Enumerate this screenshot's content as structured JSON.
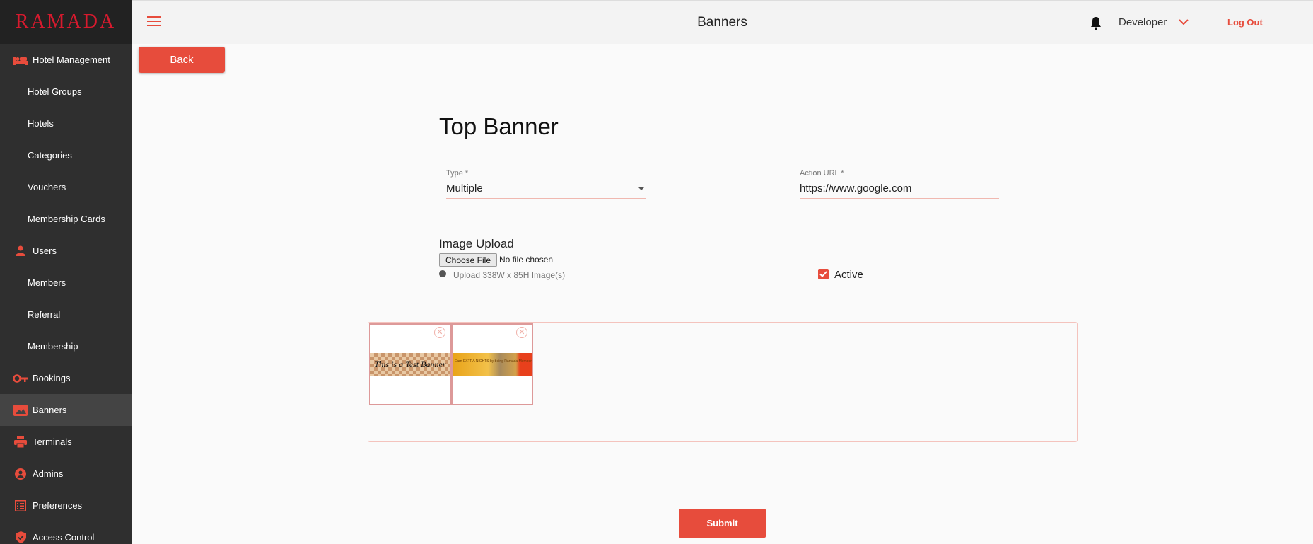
{
  "app": {
    "brand": "RAMADA",
    "page_title": "Banners"
  },
  "colors": {
    "accent": "#e74c3c",
    "sidebar_bg": "#2f2f2f",
    "brand": "#d61a2e"
  },
  "sidebar": {
    "items": [
      {
        "label": "Hotel Management",
        "icon": "bed-icon"
      },
      {
        "label": "Hotel Groups"
      },
      {
        "label": "Hotels"
      },
      {
        "label": "Categories"
      },
      {
        "label": "Vouchers"
      },
      {
        "label": "Membership Cards"
      },
      {
        "label": "Users",
        "icon": "person-icon"
      },
      {
        "label": "Members"
      },
      {
        "label": "Referral"
      },
      {
        "label": "Membership"
      },
      {
        "label": "Bookings",
        "icon": "key-icon"
      },
      {
        "label": "Banners",
        "icon": "image-icon",
        "active": true
      },
      {
        "label": "Terminals",
        "icon": "printer-icon"
      },
      {
        "label": "Admins",
        "icon": "admin-icon"
      },
      {
        "label": "Preferences",
        "icon": "list-icon"
      },
      {
        "label": "Access Control",
        "icon": "shield-icon"
      }
    ]
  },
  "header": {
    "user": "Developer",
    "logout": "Log Out"
  },
  "toolbar": {
    "back_label": "Back"
  },
  "form": {
    "title": "Top Banner",
    "type_label": "Type *",
    "type_value": "Multiple",
    "action_url_label": "Action URL *",
    "action_url_value": "https://www.google.com",
    "upload_label": "Image Upload",
    "choose_file": "Choose File",
    "no_file": "No file chosen",
    "hint": "Upload 338W x 85H Image(s)",
    "active_label": "Active",
    "active_checked": true,
    "submit_label": "Submit"
  },
  "gallery": {
    "images": [
      {
        "caption": "This is a Test Banner"
      },
      {
        "caption": "Earn EXTRA NIGHTS by being Ramada Member"
      }
    ]
  }
}
